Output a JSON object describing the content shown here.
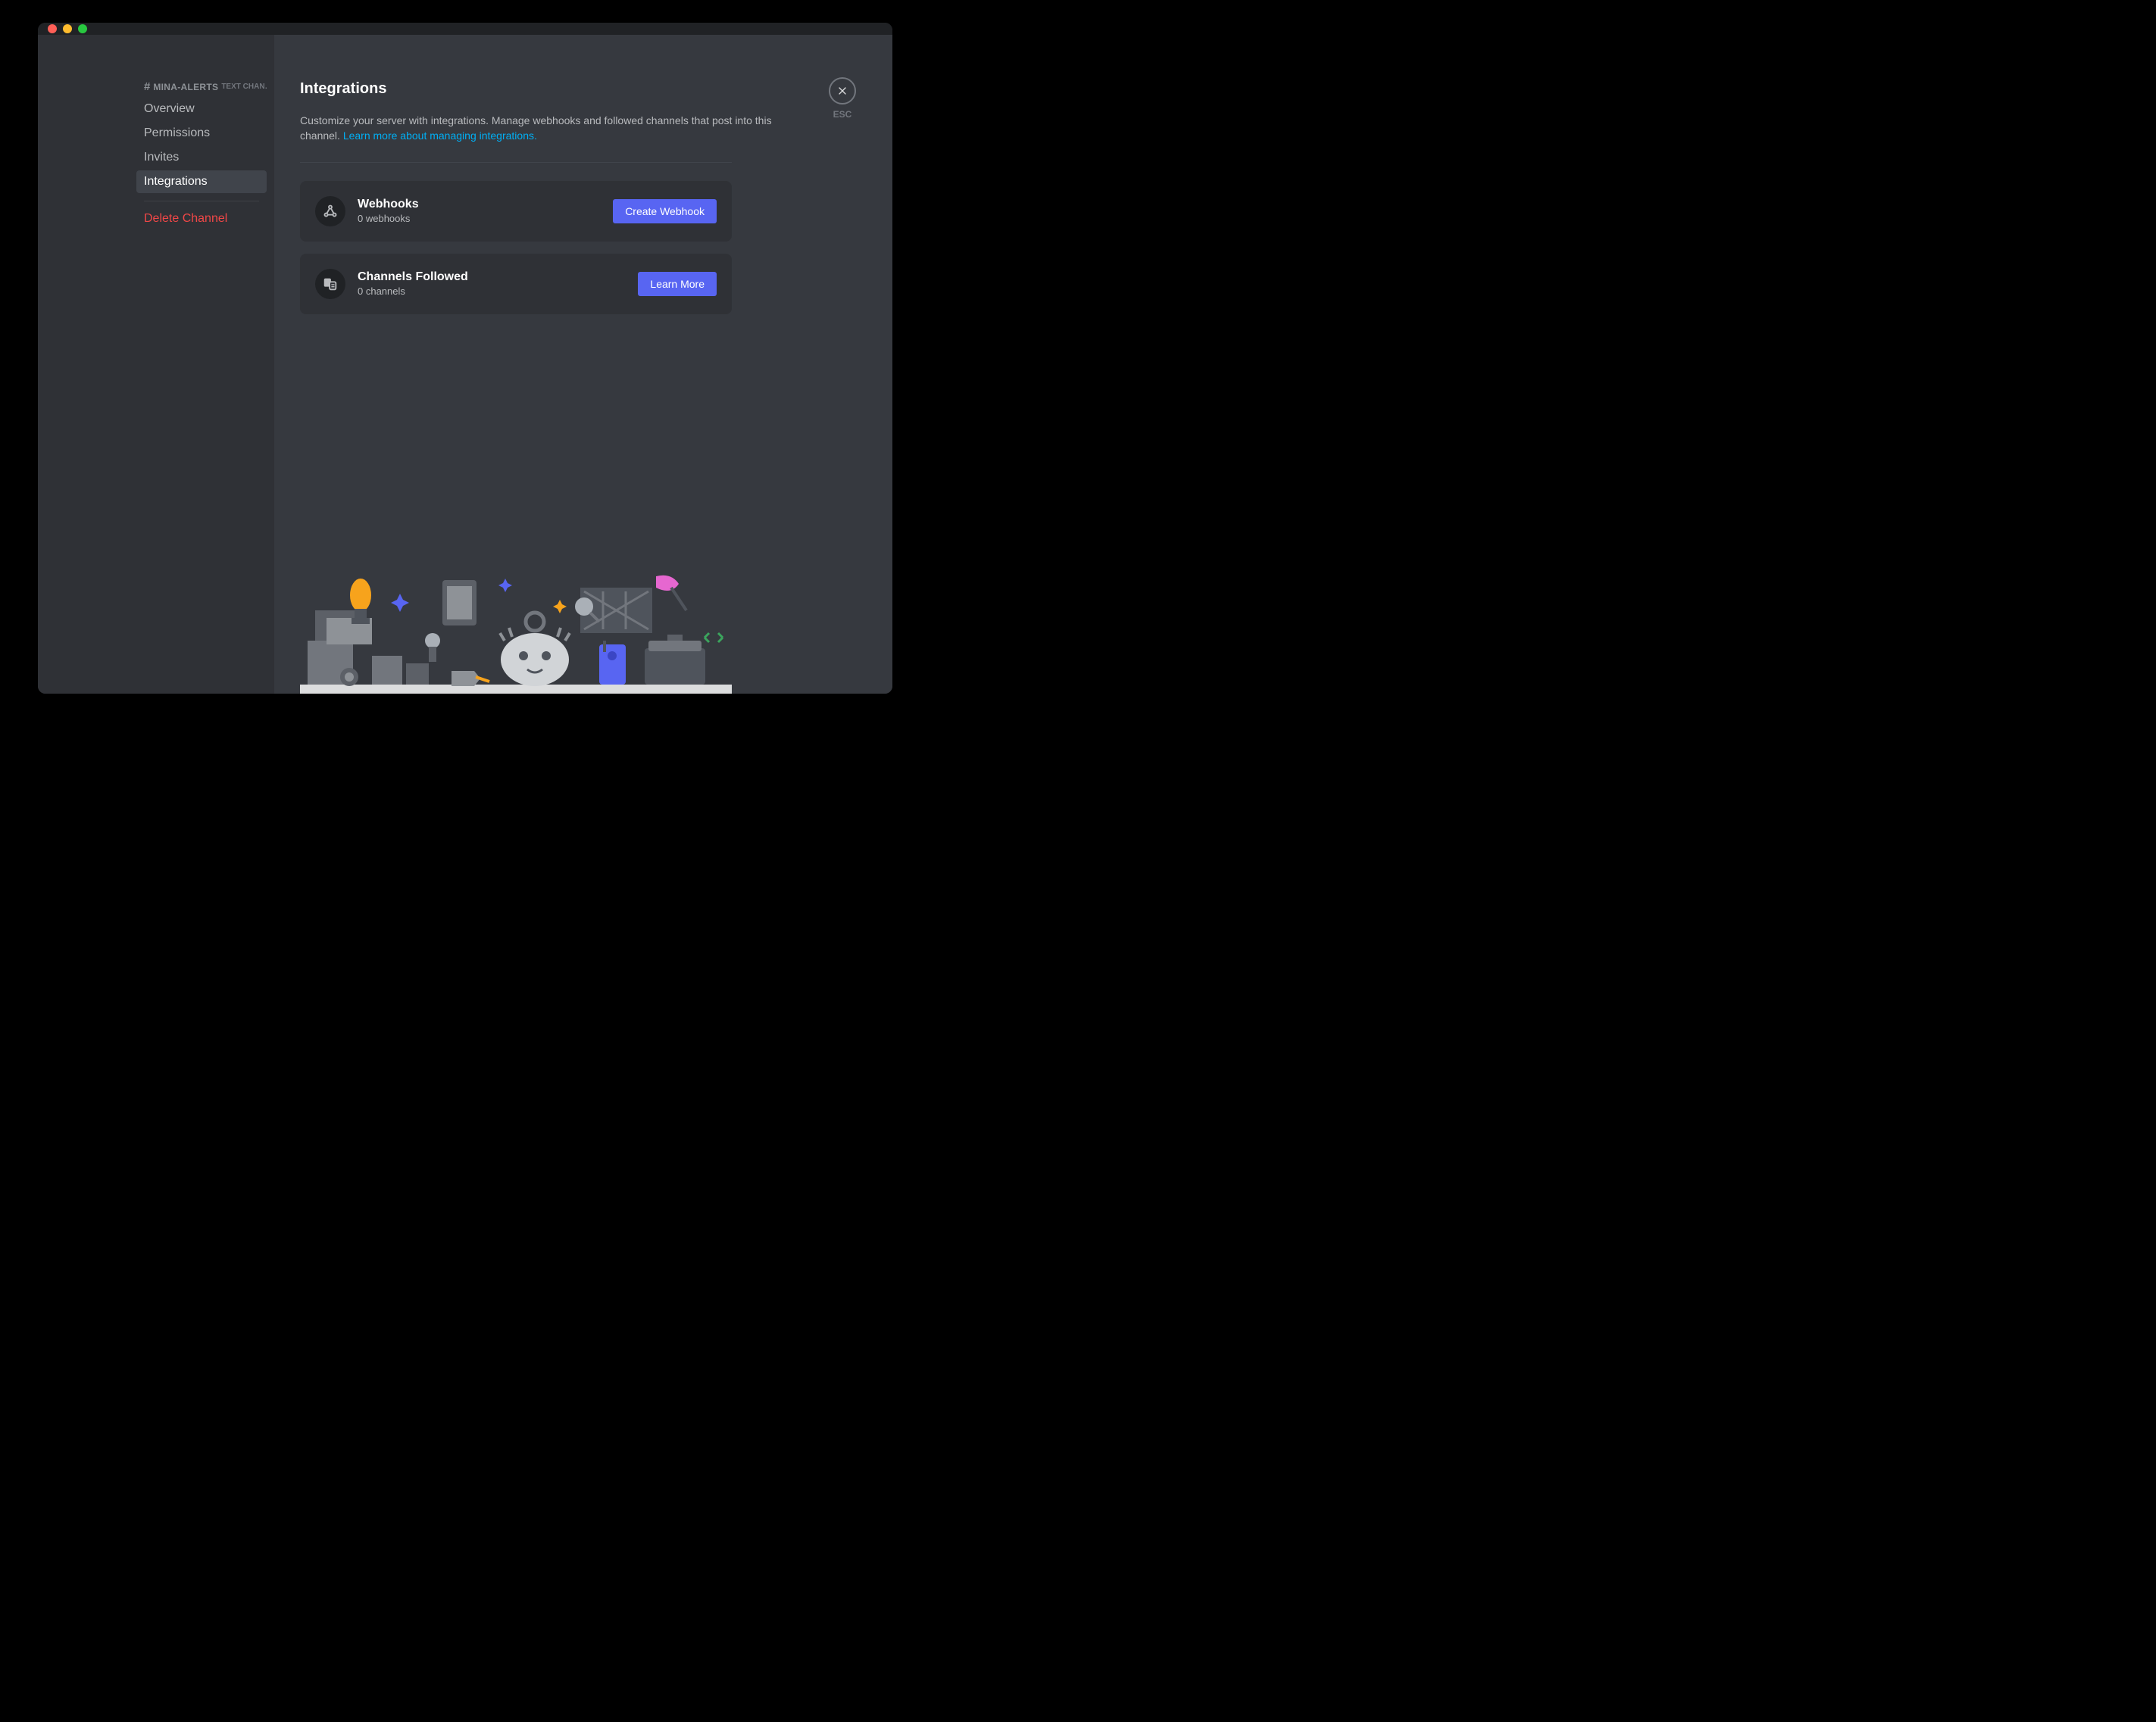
{
  "window": {
    "traffic_lights": [
      "close",
      "minimize",
      "zoom"
    ]
  },
  "sidebar": {
    "hash": "#",
    "channel_name": "MINA-ALERTS",
    "channel_suffix": "TEXT CHAN…",
    "items": [
      {
        "label": "Overview",
        "active": false
      },
      {
        "label": "Permissions",
        "active": false
      },
      {
        "label": "Invites",
        "active": false
      },
      {
        "label": "Integrations",
        "active": true
      }
    ],
    "delete_label": "Delete Channel"
  },
  "page": {
    "title": "Integrations",
    "description": "Customize your server with integrations. Manage webhooks and followed channels that post into this channel. ",
    "learn_link": "Learn more about managing integrations."
  },
  "cards": {
    "webhooks": {
      "title": "Webhooks",
      "subtitle": "0 webhooks",
      "button": "Create Webhook"
    },
    "channels_followed": {
      "title": "Channels Followed",
      "subtitle": "0 channels",
      "button": "Learn More"
    }
  },
  "close": {
    "label": "ESC"
  }
}
